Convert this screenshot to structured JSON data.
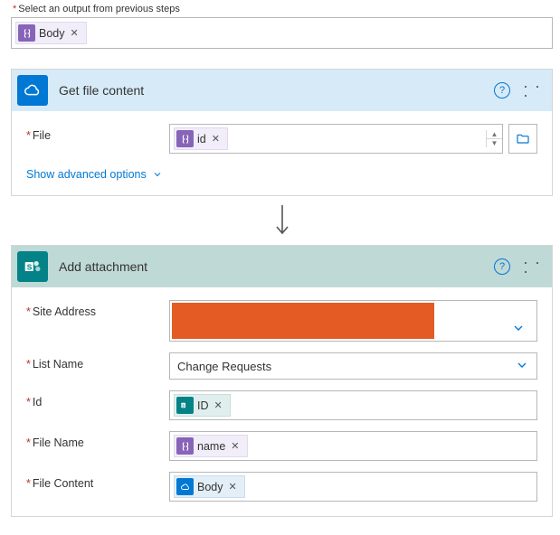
{
  "topPrompt": "Select an output from previous steps",
  "topToken": {
    "label": "Body"
  },
  "actions": {
    "getFile": {
      "title": "Get file content",
      "fields": {
        "file": {
          "label": "File",
          "token": "id"
        }
      },
      "advanced": "Show advanced options"
    },
    "addAttachment": {
      "title": "Add attachment",
      "fields": {
        "siteAddress": {
          "label": "Site Address"
        },
        "listName": {
          "label": "List Name",
          "value": "Change Requests"
        },
        "id": {
          "label": "Id",
          "token": "ID"
        },
        "fileName": {
          "label": "File Name",
          "token": "name"
        },
        "fileContent": {
          "label": "File Content",
          "token": "Body"
        }
      }
    }
  }
}
